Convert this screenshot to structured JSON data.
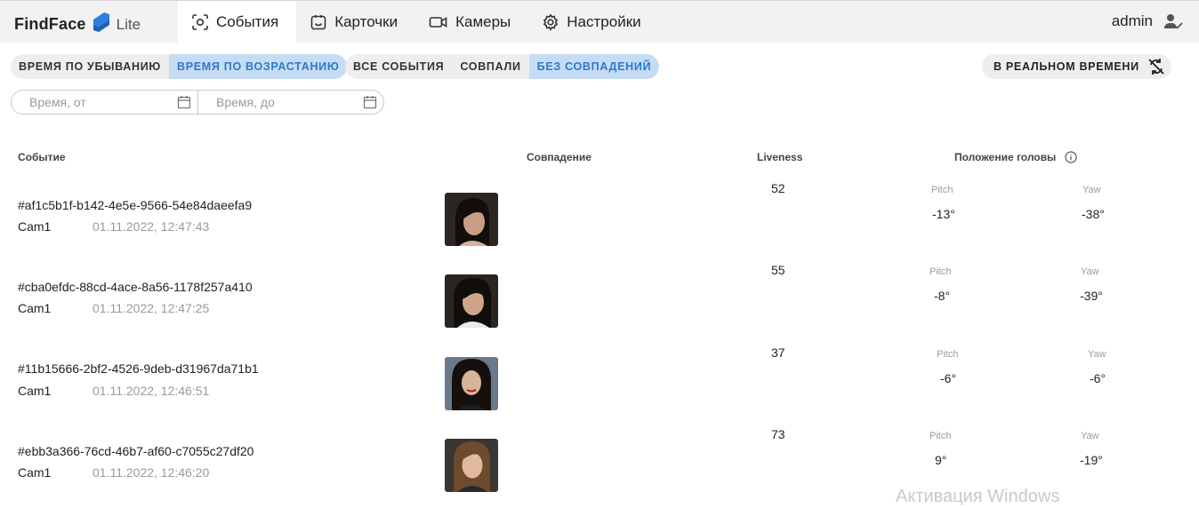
{
  "app": {
    "name": "FindFace",
    "edition": "Lite"
  },
  "nav": [
    {
      "label": "События",
      "icon": "focus-frame-icon",
      "active": true
    },
    {
      "label": "Карточки",
      "icon": "card-icon",
      "active": false
    },
    {
      "label": "Камеры",
      "icon": "camera-icon",
      "active": false
    },
    {
      "label": "Настройки",
      "icon": "gear-icon",
      "active": false
    }
  ],
  "user": {
    "name": "admin",
    "icon": "user-check-icon"
  },
  "sort": [
    {
      "label": "ВРЕМЯ ПО УБЫВАНИЮ",
      "active": false
    },
    {
      "label": "ВРЕМЯ ПО ВОЗРАСТАНИЮ",
      "active": true
    }
  ],
  "match_filter": [
    {
      "label": "ВСЕ СОБЫТИЯ",
      "active": false
    },
    {
      "label": "СОВПАЛИ",
      "active": false
    },
    {
      "label": "БЕЗ СОВПАДЕНИЙ",
      "active": true
    }
  ],
  "realtime": {
    "label": "В РЕАЛЬНОМ ВРЕМЕНИ",
    "icon": "sync-off-icon"
  },
  "date_filter": {
    "from_placeholder": "Время, от",
    "to_placeholder": "Время, до",
    "icon": "calendar-icon"
  },
  "columns": {
    "event": "Событие",
    "match": "Совпадение",
    "liveness": "Liveness",
    "head_pose": "Положение головы"
  },
  "head_pose_labels": {
    "pitch": "Pitch",
    "yaw": "Yaw"
  },
  "events": [
    {
      "id": "#af1c5b1f-b142-4e5e-9566-54e84daeefa9",
      "camera": "Cam1",
      "time": "01.11.2022, 12:47:43",
      "liveness": "52",
      "pitch": "-13°",
      "yaw": "-38°"
    },
    {
      "id": "#cba0efdc-88cd-4ace-8a56-1178f257a410",
      "camera": "Cam1",
      "time": "01.11.2022, 12:47:25",
      "liveness": "55",
      "pitch": "-8°",
      "yaw": "-39°"
    },
    {
      "id": "#11b15666-2bf2-4526-9deb-d31967da71b1",
      "camera": "Cam1",
      "time": "01.11.2022, 12:46:51",
      "liveness": "37",
      "pitch": "-6°",
      "yaw": "-6°"
    },
    {
      "id": "#ebb3a366-76cd-46b7-af60-c7055c27df20",
      "camera": "Cam1",
      "time": "01.11.2022, 12:46:20",
      "liveness": "73",
      "pitch": "9°",
      "yaw": "-19°"
    }
  ],
  "watermark": "Активация Windows",
  "colors": {
    "accent": "#2a7ad0",
    "active_chip_bg": "#c6dcf2",
    "logo_blue": "#2f7de1"
  }
}
